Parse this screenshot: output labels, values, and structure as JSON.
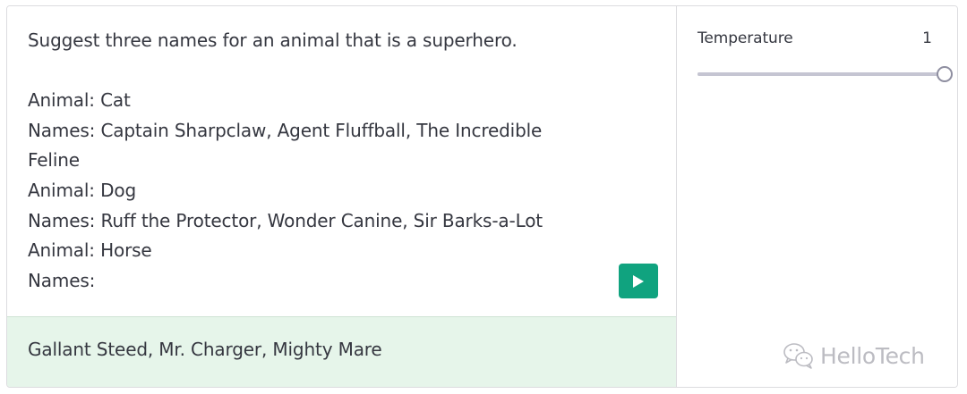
{
  "prompt": {
    "text": "Suggest three names for an animal that is a superhero.\n\nAnimal: Cat\nNames: Captain Sharpclaw, Agent Fluffball, The Incredible\nFeline\nAnimal: Dog\nNames: Ruff the Protector, Wonder Canine, Sir Barks-a-Lot\nAnimal: Horse\nNames:"
  },
  "run_button": {
    "icon": "play-icon",
    "color": "#10a37f"
  },
  "output": {
    "text": "Gallant Steed, Mr. Charger, Mighty Mare",
    "background": "#e6f5ea"
  },
  "settings": {
    "temperature_label": "Temperature",
    "temperature_value": "1",
    "temperature_fraction": 1
  },
  "watermark": {
    "icon": "wechat-icon",
    "text": "HelloTech"
  }
}
